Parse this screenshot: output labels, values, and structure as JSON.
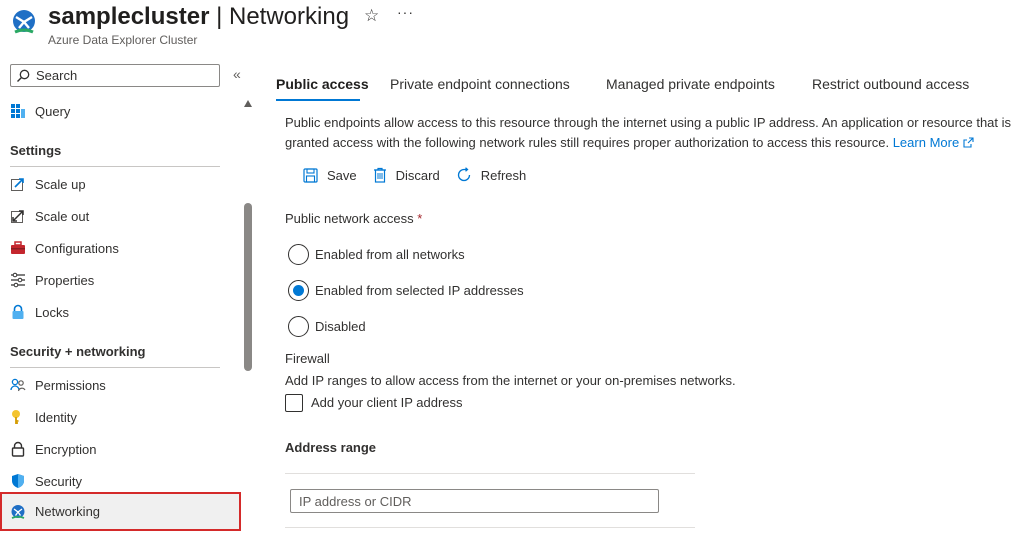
{
  "header": {
    "resource_name": "samplecluster",
    "separator": " | ",
    "page_name": "Networking",
    "subtitle": "Azure Data Explorer Cluster",
    "more": "···"
  },
  "sidebar": {
    "search_label": "Search",
    "collapse_glyph": "«",
    "top_item": "Query",
    "sections": [
      {
        "title": "Settings",
        "items": [
          "Scale up",
          "Scale out",
          "Configurations",
          "Properties",
          "Locks"
        ]
      },
      {
        "title": "Security + networking",
        "items": [
          "Permissions",
          "Identity",
          "Encryption",
          "Security",
          "Networking"
        ]
      }
    ],
    "selected": "Networking"
  },
  "tabs": [
    "Public access",
    "Private endpoint connections",
    "Managed private endpoints",
    "Restrict outbound access"
  ],
  "active_tab": "Public access",
  "content": {
    "description": "Public endpoints allow access to this resource through the internet using a public IP address. An application or resource that is granted access with the following network rules still requires proper authorization to access this resource.",
    "learn_more": "Learn More",
    "toolbar": {
      "save": "Save",
      "discard": "Discard",
      "refresh": "Refresh"
    },
    "public_network_access_label": "Public network access",
    "required_marker": "*",
    "options": [
      "Enabled from all networks",
      "Enabled from selected IP addresses",
      "Disabled"
    ],
    "selected_option": "Enabled from selected IP addresses",
    "firewall_label": "Firewall",
    "firewall_desc": "Add IP ranges to allow access from the internet or your on-premises networks.",
    "client_ip_label": "Add your client IP address",
    "client_ip_checked": false,
    "address_range_label": "Address range",
    "ip_placeholder": "IP address or CIDR"
  },
  "colors": {
    "accent": "#0078d4",
    "selection_border": "#d42a2a",
    "required": "#a4262c"
  }
}
